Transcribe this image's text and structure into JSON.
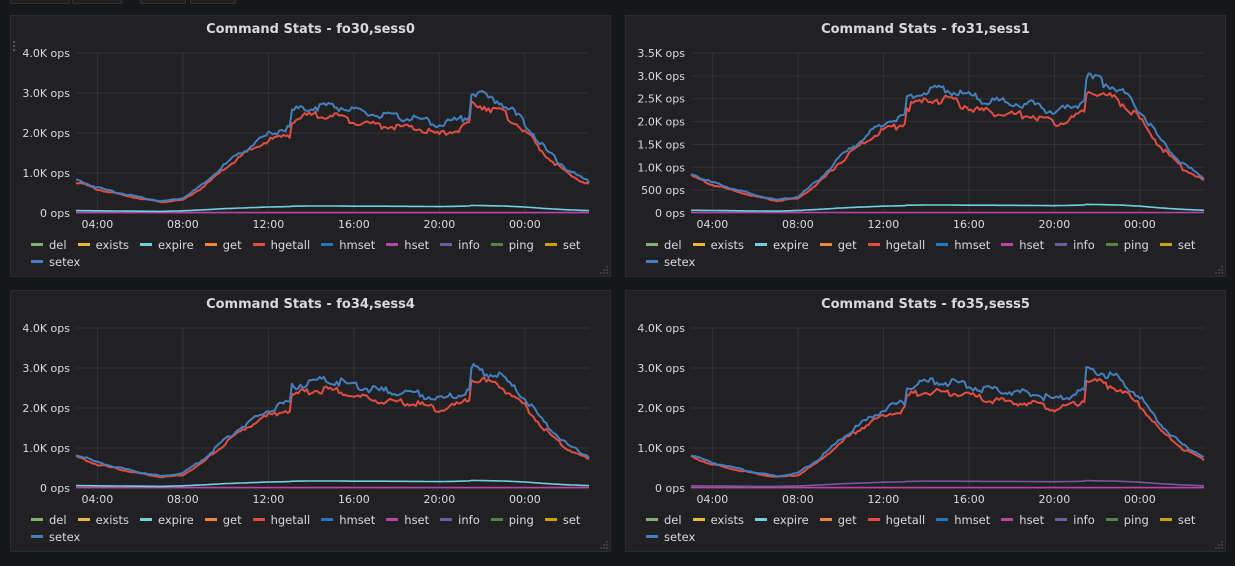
{
  "colors": {
    "background": "#161719",
    "panel_bg": "#212124",
    "grid": "#333336",
    "axis_text": "#d8d9da"
  },
  "legend_items": [
    {
      "label": "del",
      "color": "#7eb26d"
    },
    {
      "label": "exists",
      "color": "#eab839"
    },
    {
      "label": "expire",
      "color": "#6ed0e0"
    },
    {
      "label": "get",
      "color": "#ef843c"
    },
    {
      "label": "hgetall",
      "color": "#e24d42"
    },
    {
      "label": "hmset",
      "color": "#1f78c1"
    },
    {
      "label": "hset",
      "color": "#ba43a9"
    },
    {
      "label": "info",
      "color": "#705da0"
    },
    {
      "label": "ping",
      "color": "#508642"
    },
    {
      "label": "set",
      "color": "#cca300"
    },
    {
      "label": "setex",
      "color": "#447ebc"
    }
  ],
  "panels": [
    {
      "title": "Command Stats - fo30,sess0"
    },
    {
      "title": "Command Stats - fo31,sess1"
    },
    {
      "title": "Command Stats - fo34,sess4"
    },
    {
      "title": "Command Stats - fo35,sess5"
    }
  ],
  "chart_data": [
    {
      "type": "line",
      "title": "Command Stats - fo30,sess0",
      "ylim": [
        0,
        4000
      ],
      "y_ticks": [
        0,
        1000,
        2000,
        3000,
        4000
      ],
      "y_tick_labels": [
        "0 ops",
        "1.0K ops",
        "2.0K ops",
        "3.0K ops",
        "4.0K ops"
      ],
      "x_tick_labels": [
        "04:00",
        "08:00",
        "12:00",
        "16:00",
        "20:00",
        "00:00"
      ],
      "x_range_hours": [
        3.0,
        27.0
      ],
      "grid": true,
      "legend_placement": "bottom",
      "x": [
        3.0,
        4.0,
        5.0,
        6.0,
        7.0,
        8.0,
        9.0,
        10.0,
        11.0,
        12.0,
        13.0,
        13.1,
        14.0,
        15.0,
        16.0,
        17.0,
        18.0,
        19.0,
        20.0,
        21.0,
        21.4,
        21.5,
        22.0,
        23.0,
        24.0,
        25.0,
        26.0,
        27.0
      ],
      "series": [
        {
          "name": "setex",
          "values": [
            850,
            650,
            520,
            400,
            300,
            380,
            750,
            1250,
            1650,
            2000,
            2200,
            2600,
            2700,
            2750,
            2600,
            2500,
            2450,
            2400,
            2250,
            2400,
            2500,
            3080,
            3000,
            2800,
            2300,
            1600,
            1100,
            800
          ]
        },
        {
          "name": "hgetall",
          "values": [
            800,
            600,
            480,
            370,
            280,
            330,
            680,
            1150,
            1550,
            1850,
            2000,
            2350,
            2500,
            2500,
            2350,
            2250,
            2200,
            2150,
            2000,
            2150,
            2250,
            2800,
            2750,
            2550,
            2100,
            1450,
            1000,
            720
          ]
        },
        {
          "name": "expire",
          "values": [
            60,
            55,
            50,
            45,
            40,
            55,
            80,
            110,
            130,
            150,
            160,
            170,
            175,
            175,
            170,
            170,
            168,
            165,
            160,
            170,
            175,
            190,
            185,
            175,
            150,
            110,
            80,
            60
          ]
        },
        {
          "name": "hset",
          "values": [
            10,
            10,
            10,
            10,
            10,
            10,
            10,
            10,
            10,
            10,
            10,
            10,
            10,
            10,
            10,
            10,
            10,
            10,
            10,
            10,
            10,
            10,
            10,
            10,
            10,
            10,
            10,
            10
          ]
        }
      ]
    },
    {
      "type": "line",
      "title": "Command Stats - fo31,sess1",
      "ylim": [
        0,
        3500
      ],
      "y_ticks": [
        0,
        500,
        1000,
        1500,
        2000,
        2500,
        3000,
        3500
      ],
      "y_tick_labels": [
        "0 ops",
        "500 ops",
        "1.0K ops",
        "1.5K ops",
        "2.0K ops",
        "2.5K ops",
        "3.0K ops",
        "3.5K ops"
      ],
      "x_tick_labels": [
        "04:00",
        "08:00",
        "12:00",
        "16:00",
        "20:00",
        "00:00"
      ],
      "x_range_hours": [
        3.0,
        27.0
      ],
      "grid": true,
      "legend_placement": "bottom",
      "x": [
        3.0,
        4.0,
        5.0,
        6.0,
        7.0,
        8.0,
        9.0,
        10.0,
        11.0,
        12.0,
        13.0,
        13.1,
        14.0,
        15.0,
        16.0,
        17.0,
        18.0,
        19.0,
        20.0,
        21.0,
        21.4,
        21.5,
        22.0,
        23.0,
        24.0,
        25.0,
        26.0,
        27.0
      ],
      "series": [
        {
          "name": "setex",
          "values": [
            880,
            680,
            540,
            400,
            290,
            360,
            750,
            1250,
            1650,
            2000,
            2200,
            2600,
            2700,
            2780,
            2600,
            2500,
            2450,
            2420,
            2250,
            2400,
            2550,
            3020,
            2980,
            2780,
            2300,
            1600,
            1100,
            780
          ]
        },
        {
          "name": "hgetall",
          "values": [
            830,
            630,
            500,
            370,
            270,
            320,
            680,
            1150,
            1550,
            1850,
            2000,
            2350,
            2500,
            2550,
            2350,
            2250,
            2200,
            2180,
            2000,
            2150,
            2250,
            2750,
            2700,
            2520,
            2100,
            1450,
            1000,
            720
          ]
        },
        {
          "name": "expire",
          "values": [
            60,
            55,
            50,
            45,
            40,
            55,
            80,
            110,
            130,
            150,
            160,
            170,
            175,
            175,
            170,
            170,
            168,
            165,
            160,
            170,
            175,
            190,
            185,
            175,
            150,
            110,
            80,
            60
          ]
        },
        {
          "name": "hset",
          "values": [
            10,
            10,
            10,
            10,
            10,
            10,
            10,
            10,
            10,
            10,
            10,
            10,
            10,
            10,
            10,
            10,
            10,
            10,
            10,
            10,
            10,
            10,
            10,
            10,
            10,
            10,
            10,
            10
          ]
        }
      ]
    },
    {
      "type": "line",
      "title": "Command Stats - fo34,sess4",
      "ylim": [
        0,
        4000
      ],
      "y_ticks": [
        0,
        1000,
        2000,
        3000,
        4000
      ],
      "y_tick_labels": [
        "0 ops",
        "1.0K ops",
        "2.0K ops",
        "3.0K ops",
        "4.0K ops"
      ],
      "x_tick_labels": [
        "04:00",
        "08:00",
        "12:00",
        "16:00",
        "20:00",
        "00:00"
      ],
      "x_range_hours": [
        3.0,
        27.0
      ],
      "grid": true,
      "legend_placement": "bottom",
      "x": [
        3.0,
        4.0,
        5.0,
        6.0,
        7.0,
        8.0,
        9.0,
        10.0,
        11.0,
        12.0,
        13.0,
        13.1,
        14.0,
        15.0,
        16.0,
        17.0,
        18.0,
        19.0,
        20.0,
        21.0,
        21.4,
        21.5,
        22.0,
        23.0,
        24.0,
        25.0,
        26.0,
        27.0
      ],
      "series": [
        {
          "name": "setex",
          "values": [
            850,
            650,
            520,
            400,
            300,
            380,
            750,
            1250,
            1650,
            2000,
            2200,
            2600,
            2700,
            2750,
            2600,
            2500,
            2450,
            2400,
            2250,
            2400,
            2500,
            3050,
            3000,
            2800,
            2300,
            1600,
            1100,
            800
          ]
        },
        {
          "name": "hgetall",
          "values": [
            800,
            600,
            480,
            370,
            280,
            330,
            680,
            1150,
            1550,
            1850,
            2000,
            2350,
            2500,
            2500,
            2350,
            2250,
            2200,
            2150,
            2000,
            2150,
            2250,
            2780,
            2750,
            2550,
            2100,
            1450,
            1000,
            720
          ]
        },
        {
          "name": "expire",
          "values": [
            60,
            55,
            50,
            45,
            40,
            55,
            80,
            110,
            130,
            150,
            160,
            170,
            175,
            175,
            170,
            170,
            168,
            165,
            160,
            170,
            175,
            190,
            185,
            175,
            150,
            110,
            80,
            60
          ]
        },
        {
          "name": "hset",
          "values": [
            10,
            10,
            10,
            10,
            10,
            10,
            10,
            10,
            10,
            10,
            10,
            10,
            10,
            10,
            10,
            10,
            10,
            10,
            10,
            10,
            10,
            10,
            10,
            10,
            10,
            10,
            10,
            10
          ]
        }
      ]
    },
    {
      "type": "line",
      "title": "Command Stats - fo35,sess5",
      "ylim": [
        0,
        4000
      ],
      "y_ticks": [
        0,
        1000,
        2000,
        3000,
        4000
      ],
      "y_tick_labels": [
        "0 ops",
        "1.0K ops",
        "2.0K ops",
        "3.0K ops",
        "4.0K ops"
      ],
      "x_tick_labels": [
        "04:00",
        "08:00",
        "12:00",
        "16:00",
        "20:00",
        "00:00"
      ],
      "x_range_hours": [
        3.0,
        27.0
      ],
      "grid": true,
      "legend_placement": "bottom",
      "x": [
        3.0,
        4.0,
        5.0,
        6.0,
        7.0,
        8.0,
        9.0,
        10.0,
        11.0,
        12.0,
        13.0,
        13.1,
        14.0,
        15.0,
        16.0,
        17.0,
        18.0,
        19.0,
        20.0,
        21.0,
        21.4,
        21.5,
        22.0,
        23.0,
        24.0,
        25.0,
        26.0,
        27.0
      ],
      "series": [
        {
          "name": "setex",
          "values": [
            850,
            650,
            520,
            400,
            300,
            380,
            750,
            1250,
            1650,
            2000,
            2200,
            2600,
            2700,
            2700,
            2600,
            2500,
            2450,
            2400,
            2250,
            2400,
            2500,
            3050,
            3000,
            2800,
            2300,
            1600,
            1100,
            800
          ]
        },
        {
          "name": "hgetall",
          "values": [
            800,
            600,
            480,
            370,
            280,
            330,
            680,
            1150,
            1550,
            1850,
            2000,
            2350,
            2450,
            2450,
            2350,
            2250,
            2200,
            2150,
            2000,
            2150,
            2250,
            2760,
            2720,
            2550,
            2100,
            1450,
            1000,
            720
          ]
        },
        {
          "name": "info",
          "values": [
            55,
            50,
            45,
            40,
            40,
            50,
            75,
            105,
            125,
            145,
            155,
            165,
            170,
            170,
            168,
            165,
            165,
            160,
            158,
            165,
            170,
            185,
            180,
            170,
            145,
            105,
            78,
            55
          ]
        },
        {
          "name": "hset",
          "values": [
            10,
            10,
            10,
            10,
            10,
            10,
            10,
            10,
            10,
            10,
            10,
            10,
            10,
            10,
            10,
            10,
            10,
            10,
            10,
            10,
            10,
            10,
            10,
            10,
            10,
            10,
            10,
            10
          ]
        }
      ]
    }
  ]
}
